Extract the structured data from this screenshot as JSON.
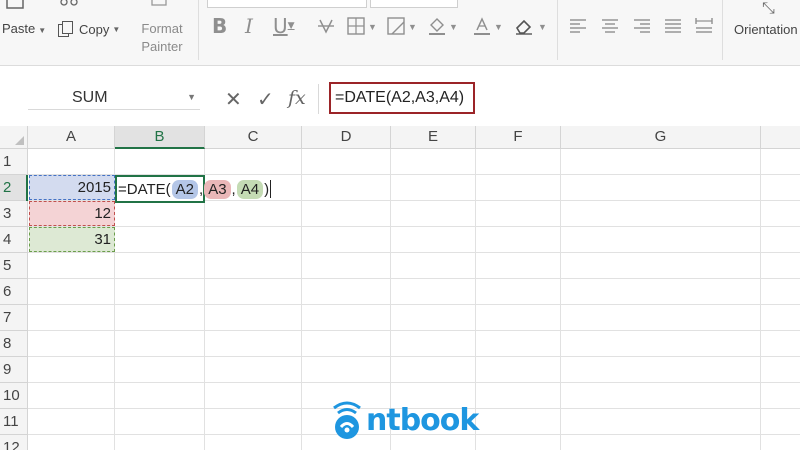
{
  "ribbon": {
    "paste_label": "Paste",
    "copy_label": "Copy",
    "format_painter_line1": "Format",
    "format_painter_line2": "Painter",
    "bold_label": "B",
    "italic_label": "I",
    "underline_label": "U",
    "orientation_label": "Orientation"
  },
  "formula_bar": {
    "name_box": "SUM",
    "cancel_icon": "✕",
    "enter_icon": "✓",
    "fx_label": "fx",
    "formula": "=DATE(A2,A3,A4)"
  },
  "sheet": {
    "columns": [
      "A",
      "B",
      "C",
      "D",
      "E",
      "F",
      "G"
    ],
    "selected_column": "B",
    "rows": [
      "1",
      "2",
      "3",
      "4",
      "5",
      "6",
      "7",
      "8",
      "9",
      "10",
      "11",
      "12"
    ],
    "selected_row": "2",
    "cells": {
      "A2": "2015",
      "A3": "12",
      "A4": "31"
    },
    "active_cell": "B2",
    "edit": {
      "prefix": "=DATE(",
      "ref1": "A2",
      "sep1": ",",
      "ref2": "A3",
      "sep2": ",",
      "ref3": "A4",
      "suffix": ")"
    },
    "ref_colors": {
      "A2": "#4472c4",
      "A3": "#c0504d",
      "A4": "#6b9d4b"
    }
  },
  "watermark": {
    "text": "ntbook",
    "color": "#1e96e0"
  }
}
